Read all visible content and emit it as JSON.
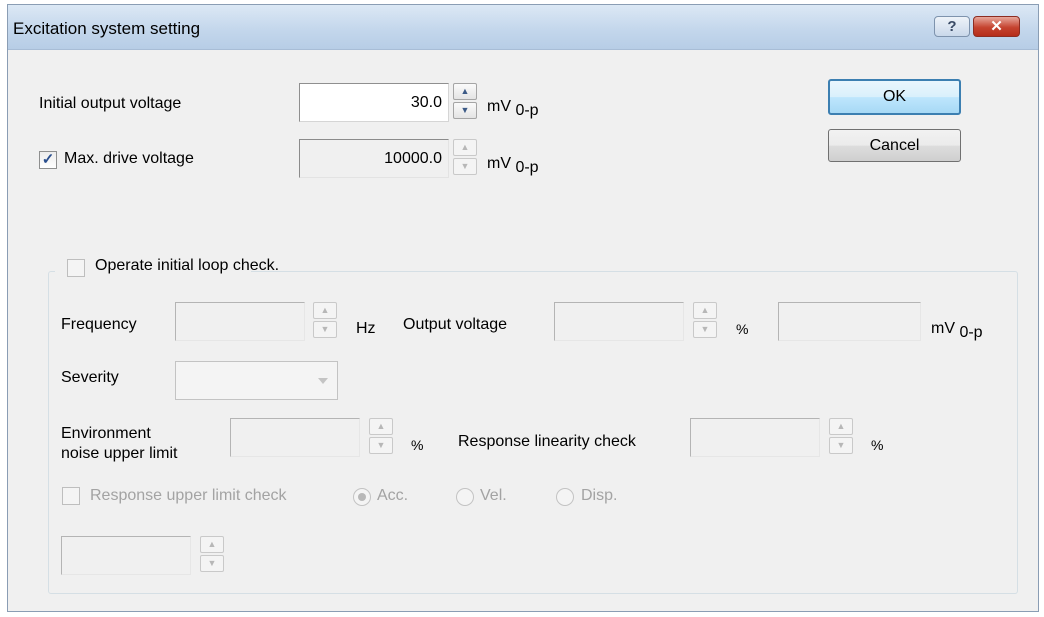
{
  "window": {
    "title": "Excitation system setting",
    "help_symbol": "?",
    "close_symbol": "✕"
  },
  "initial_output_voltage": {
    "label": "Initial output voltage",
    "value": "30.0",
    "unit": "mV",
    "unit_sub": "0-p"
  },
  "max_drive_voltage": {
    "label": "Max. drive voltage",
    "checked": true,
    "value": "10000.0",
    "unit": "mV",
    "unit_sub": "0-p"
  },
  "buttons": {
    "ok": "OK",
    "cancel": "Cancel"
  },
  "loop_check": {
    "label": "Operate initial loop check.",
    "checked": false,
    "frequency": {
      "label": "Frequency",
      "value": "",
      "unit": "Hz"
    },
    "output_voltage": {
      "label": "Output voltage",
      "value": "",
      "unit": "%",
      "mv_value": "",
      "mv_unit": "mV",
      "mv_unit_sub": "0-p"
    },
    "severity": {
      "label": "Severity",
      "selected": ""
    },
    "environment_noise": {
      "label_line1": "Environment",
      "label_line2": "noise upper limit",
      "value": "",
      "unit": "%"
    },
    "response_linearity": {
      "label": "Response linearity check",
      "value": "",
      "unit": "%"
    },
    "response_upper_limit": {
      "label": "Response upper limit check",
      "checked": false,
      "options": [
        "Acc.",
        "Vel.",
        "Disp."
      ],
      "selected": "Acc.",
      "value": ""
    }
  },
  "icons": {
    "spin_up": "▲",
    "spin_down": "▼",
    "check_mark": "✓"
  }
}
